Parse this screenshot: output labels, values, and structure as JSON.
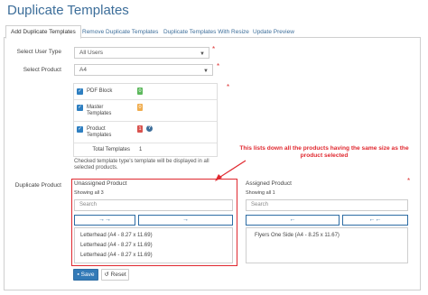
{
  "page": {
    "title": "Duplicate Templates"
  },
  "tabs": [
    {
      "label": "Add Duplicate Templates",
      "active": true
    },
    {
      "label": "Remove Duplicate Templates",
      "active": false
    },
    {
      "label": "Duplicate Templates With Resize",
      "active": false
    },
    {
      "label": "Update Preview",
      "active": false
    }
  ],
  "form": {
    "user_type": {
      "label": "Select User Type",
      "value": "All Users",
      "required": "*"
    },
    "product": {
      "label": "Select Product",
      "value": "A4",
      "required": "*"
    },
    "template_types": {
      "required": "*",
      "rows": [
        {
          "name": "PDF Block",
          "count": "0",
          "color": "#5cb85c",
          "checked": true
        },
        {
          "name": "Master Templates",
          "count": "0",
          "color": "#f0ad4e",
          "checked": true
        },
        {
          "name": "Product Templates",
          "count": "1",
          "color": "#d9534f",
          "checked": true
        }
      ],
      "total_label": "Total Templates",
      "total_value": "1",
      "help": "?"
    },
    "note": "Checked template type's template will be displayed in all selected products.",
    "duplicate_label": "Duplicate Product"
  },
  "callout": {
    "text": "This lists down all the products having the same size as the product selected"
  },
  "unassigned": {
    "title": "Unassigned Product",
    "showing": "Showing all 3",
    "search_placeholder": "Search",
    "move_all": "→→",
    "move_one": "→",
    "items": [
      "Letterhead (A4 - 8.27 x 11.69)",
      "Letterhead (A4 - 8.27 x 11.69)",
      "Letterhead (A4 - 8.27 x 11.69)"
    ]
  },
  "assigned": {
    "title": "Assigned Product",
    "showing": "Showing all 1",
    "search_placeholder": "Search",
    "move_one": "←",
    "move_all": "←←",
    "required": "*",
    "items": [
      "Flyers One Side (A4 - 8.25 x 11.67)"
    ]
  },
  "buttons": {
    "save": "Save",
    "reset": "Reset"
  },
  "icons": {
    "save": "floppy-disk-icon",
    "reset": "undo-icon",
    "check": "checkmark-icon",
    "dropdown": "chevron-down-icon"
  },
  "colors": {
    "accent": "#337ab7",
    "callout": "#e0282f"
  }
}
